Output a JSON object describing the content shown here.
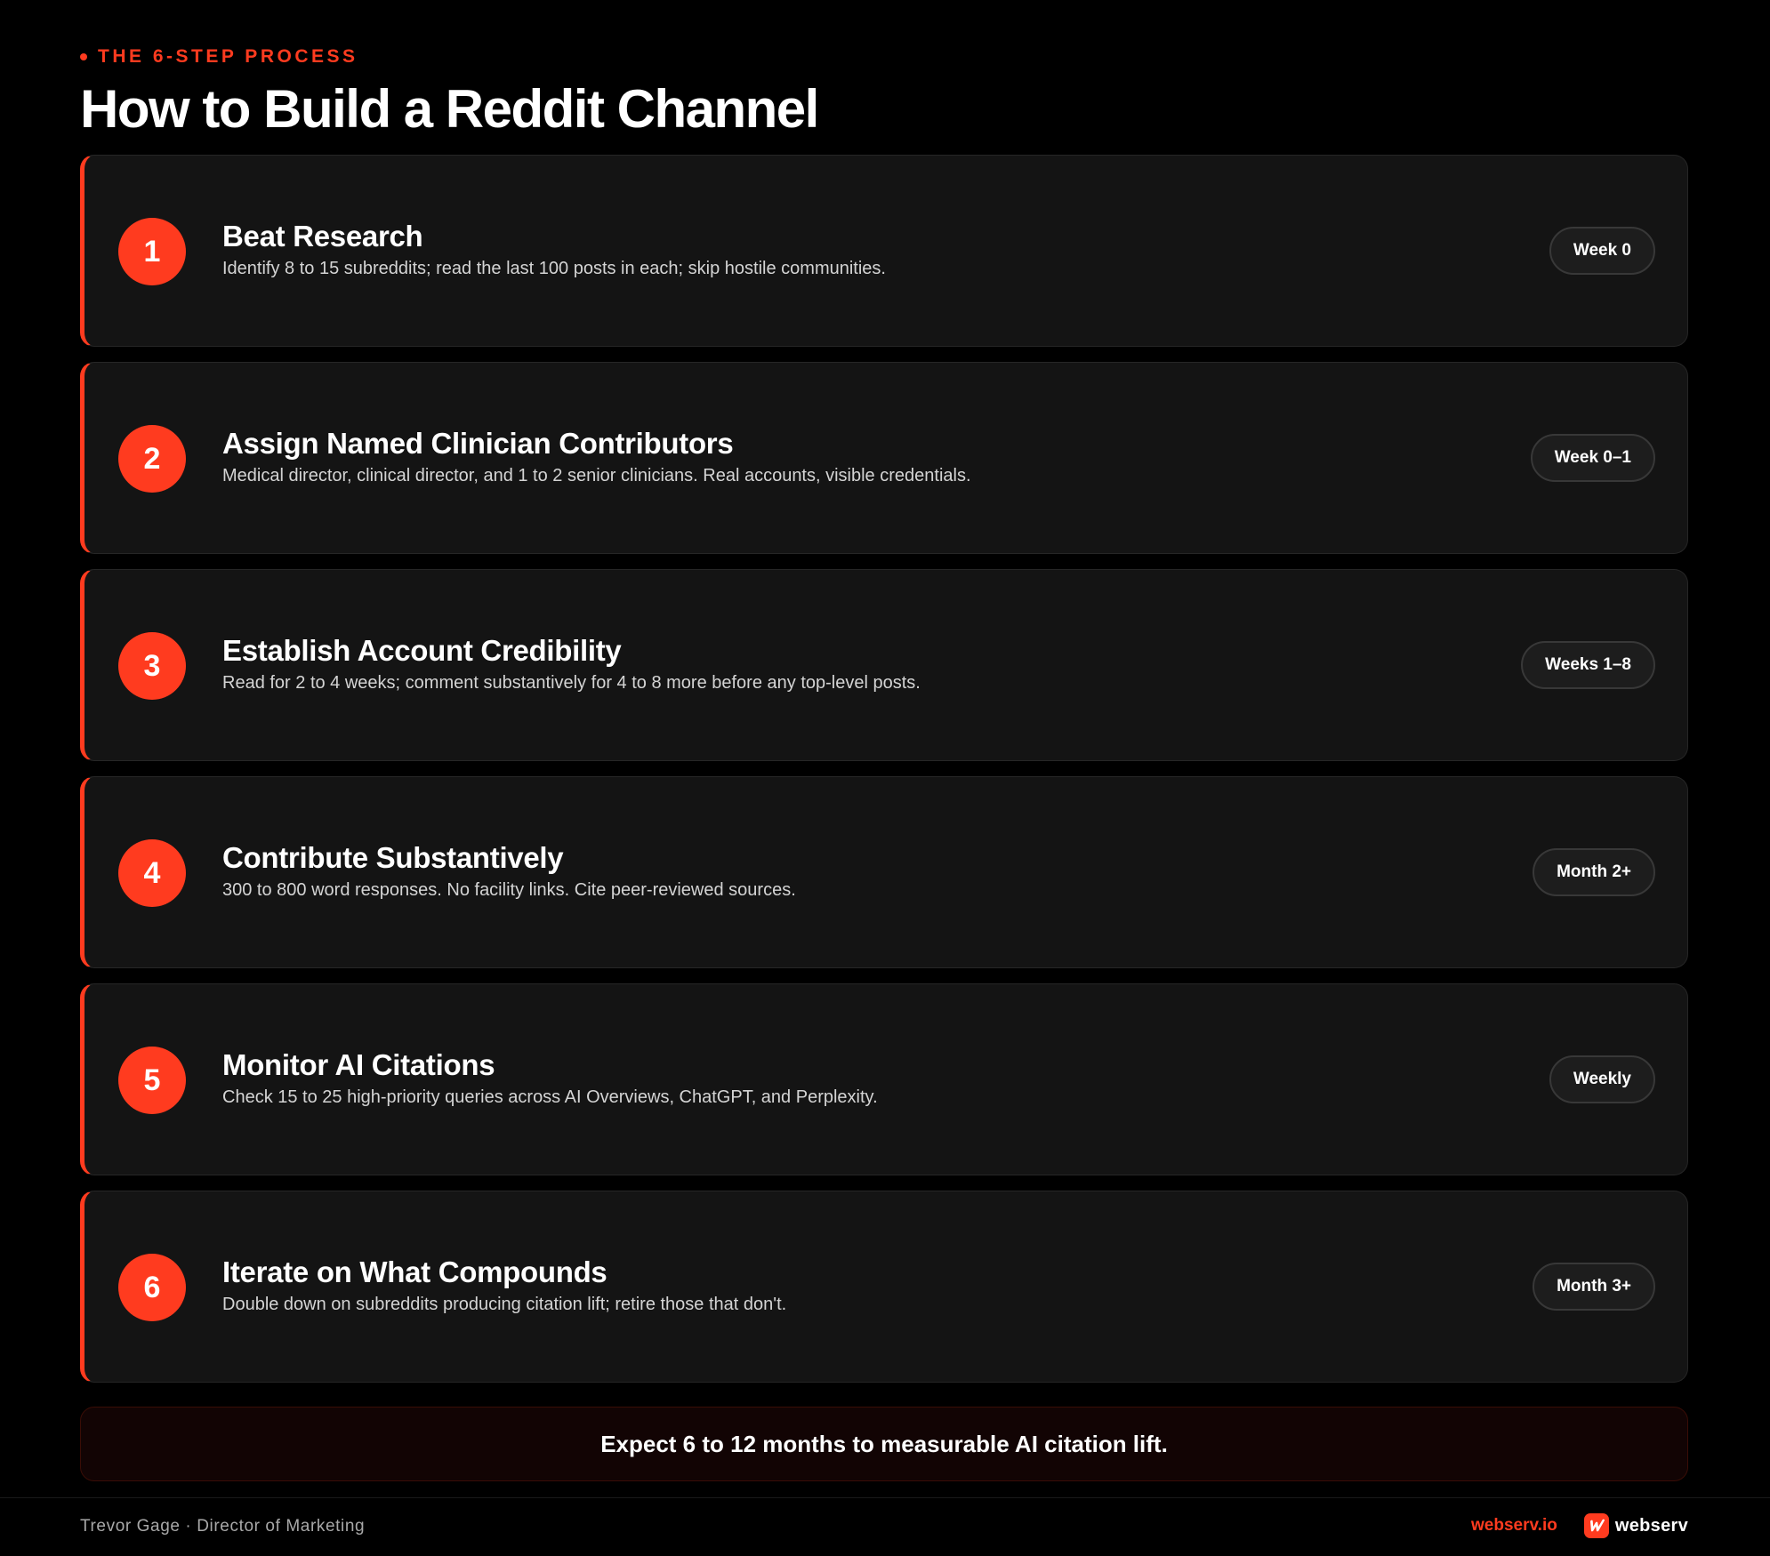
{
  "header": {
    "eyebrow": "THE 6-STEP PROCESS",
    "title": "How to Build a Reddit Channel"
  },
  "steps": [
    {
      "number": "1",
      "title": "Beat Research",
      "description": "Identify 8 to 15 subreddits; read the last 100 posts in each; skip hostile communities.",
      "badge": "Week 0"
    },
    {
      "number": "2",
      "title": "Assign Named Clinician Contributors",
      "description": "Medical director, clinical director, and 1 to 2 senior clinicians. Real accounts, visible credentials.",
      "badge": "Week 0–1"
    },
    {
      "number": "3",
      "title": "Establish Account Credibility",
      "description": "Read for 2 to 4 weeks; comment substantively for 4 to 8 more before any top-level posts.",
      "badge": "Weeks 1–8"
    },
    {
      "number": "4",
      "title": "Contribute Substantively",
      "description": "300 to 800 word responses. No facility links. Cite peer-reviewed sources.",
      "badge": "Month 2+"
    },
    {
      "number": "5",
      "title": "Monitor AI Citations",
      "description": "Check 15 to 25 high-priority queries across AI Overviews, ChatGPT, and Perplexity.",
      "badge": "Weekly"
    },
    {
      "number": "6",
      "title": "Iterate on What Compounds",
      "description": "Double down on subreddits producing citation lift; retire those that don't.",
      "badge": "Month 3+"
    }
  ],
  "callout": "Expect 6 to 12 months to measurable AI citation lift.",
  "footer": {
    "author": "Trevor Gage · Director of Marketing",
    "url": "webserv.io",
    "brand_name": "webserv",
    "logo_icon": "webserv-logo-icon"
  },
  "colors": {
    "accent": "#ff3b1f",
    "background": "#000000",
    "card": "#141414"
  }
}
